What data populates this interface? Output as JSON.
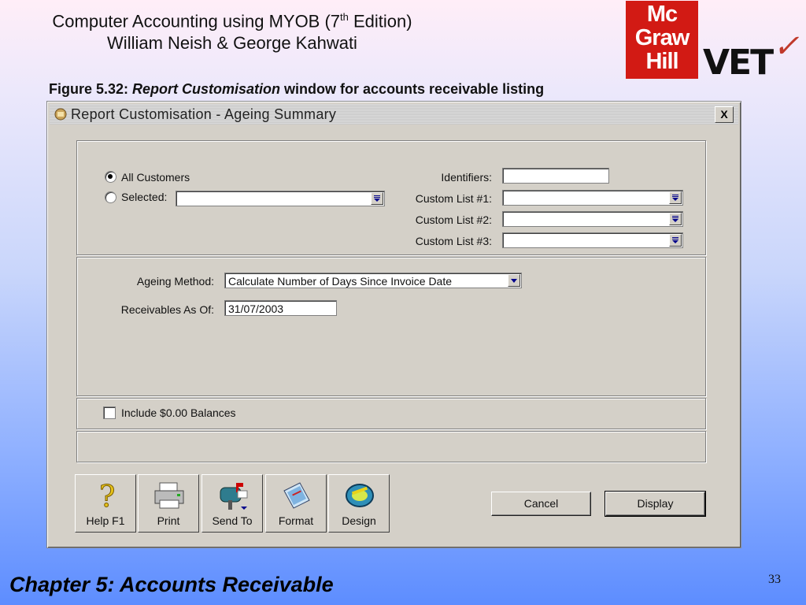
{
  "slide": {
    "title_line1_pre": "Computer Accounting using MYOB (7",
    "title_line1_sup": "th",
    "title_line1_post": " Edition)",
    "title_line2": "William Neish & George Kahwati",
    "caption_prefix": "Figure 5.32: ",
    "caption_italic": "Report Customisation",
    "caption_suffix": " window for accounts receivable listing",
    "footer_chapter": "Chapter 5: Accounts Receivable",
    "page_number": "33",
    "logo_mcgrawhill": [
      "Mc",
      "Graw",
      "Hill"
    ],
    "logo_vet": "VET"
  },
  "window": {
    "title": "Report Customisation - Ageing Summary",
    "close_label": "X"
  },
  "selection": {
    "all_customers": "All Customers",
    "selected": "Selected:",
    "selected_value": "",
    "all_customers_checked": true
  },
  "filters": {
    "identifiers_label": "Identifiers:",
    "identifiers_value": "",
    "custom1_label": "Custom List #1:",
    "custom2_label": "Custom List #2:",
    "custom3_label": "Custom List #3:",
    "custom1_value": "",
    "custom2_value": "",
    "custom3_value": ""
  },
  "ageing": {
    "method_label": "Ageing Method:",
    "method_value": "Calculate Number of Days Since Invoice Date",
    "as_of_label": "Receivables As Of:",
    "as_of_value": "31/07/2003"
  },
  "options": {
    "include_zero_label": "Include $0.00 Balances",
    "include_zero_checked": false
  },
  "toolbar": {
    "help": "Help F1",
    "print": "Print",
    "send_to": "Send To",
    "format": "Format",
    "design": "Design"
  },
  "actions": {
    "cancel": "Cancel",
    "display": "Display"
  },
  "icons": [
    "help-icon",
    "printer-icon",
    "mailbox-icon",
    "format-icon",
    "design-icon",
    "dropdown-arrow-icon",
    "window-icon"
  ]
}
